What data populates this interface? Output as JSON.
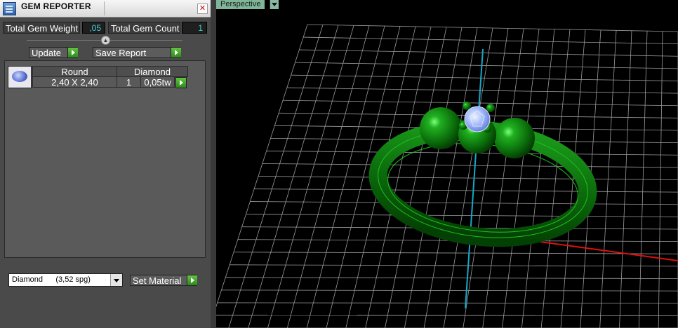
{
  "panel": {
    "title": "GEM REPORTER",
    "total_weight_label": "Total Gem Weight",
    "total_weight_value": ",05",
    "total_count_label": "Total Gem Count",
    "total_count_value": "1",
    "update_label": "Update",
    "save_report_label": "Save Report",
    "table_headers": [
      "Round",
      "Diamond"
    ],
    "gems": [
      {
        "size": "2,40 X 2,40",
        "count": "1",
        "weight": "0,05tw",
        "icon": "diamond-thumbnail-icon"
      }
    ],
    "material_selected": "Diamond      (3,52 spg)",
    "set_material_label": "Set Material"
  },
  "viewport": {
    "view_name": "Perspective"
  },
  "colors": {
    "panel_bg": "#4a4a4a",
    "viewport_bg": "#000000",
    "grid": "#9a9a9a",
    "ring": "#0f7a0f",
    "gem": "#a9c3ff",
    "axis_x": "#e01010",
    "axis_y": "#16a8c8",
    "accent_button": "#3fa82a"
  }
}
